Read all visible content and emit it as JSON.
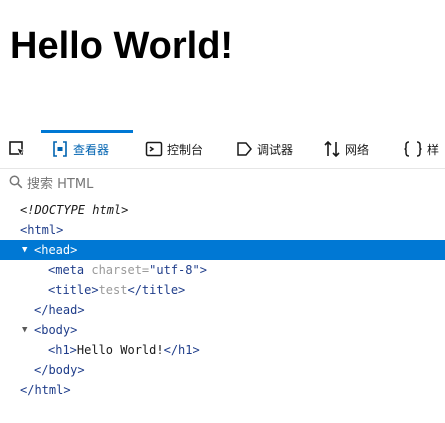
{
  "page": {
    "heading": "Hello World!"
  },
  "toolbar": {
    "items": [
      {
        "name": "inspect",
        "label": "",
        "icon": "element-picker-icon"
      },
      {
        "name": "elements",
        "label": "查看器",
        "icon": "elements-icon",
        "active": true
      },
      {
        "name": "console",
        "label": "控制台",
        "icon": "console-icon"
      },
      {
        "name": "debugger",
        "label": "调试器",
        "icon": "debugger-icon"
      },
      {
        "name": "network",
        "label": "网络",
        "icon": "network-icon"
      },
      {
        "name": "style",
        "label": "样",
        "icon": "braces-icon"
      }
    ],
    "accent_color": "#0078d4"
  },
  "search": {
    "placeholder": "搜索 HTML",
    "icon": "search-icon"
  },
  "dom": {
    "doctype": "<!DOCTYPE html>",
    "html_open": "<html>",
    "head_open": "<head>",
    "meta_open": "<meta ",
    "meta_attr_name": "charset=",
    "meta_attr_val": "\"utf-8\"",
    "meta_close": ">",
    "title_open": "<title>",
    "title_text": "test",
    "title_close": "</title>",
    "head_close": "</head>",
    "body_open": "<body>",
    "h1_open": "<h1>",
    "h1_text": "Hello World!",
    "h1_close": "</h1>",
    "body_close": "</body>",
    "html_close": "</html>"
  }
}
